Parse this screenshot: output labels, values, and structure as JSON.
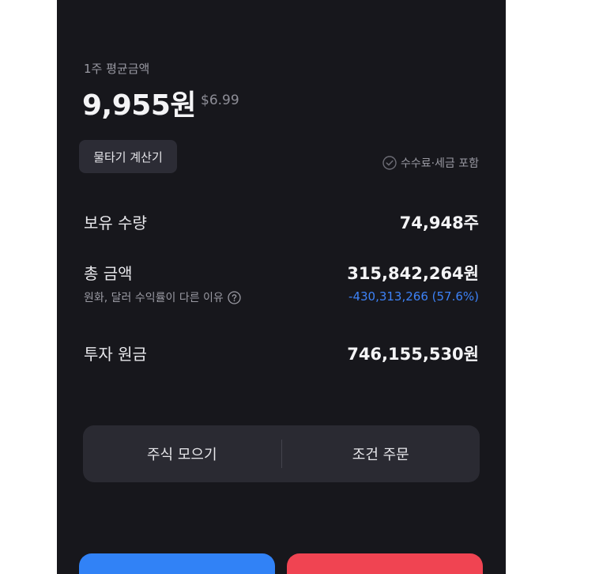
{
  "average": {
    "label": "1주 평균금액",
    "price": "9,955원",
    "usd": "$6.99"
  },
  "calculator": {
    "label": "물타기 계산기"
  },
  "fee_note": {
    "label": "수수료·세금 포함",
    "icon": "check-circle-icon"
  },
  "holdings": {
    "quantity_label": "보유 수량",
    "quantity_value": "74,948주",
    "total_label": "총 금액",
    "total_value": "315,842,264원",
    "fx_note": "원화, 달러 수익률이 다른 이유",
    "loss": "-430,313,266 (57.6%)",
    "principal_label": "투자 원금",
    "principal_value": "746,155,530원"
  },
  "actions": {
    "collect_label": "주식 모으기",
    "conditional_label": "조건 주문"
  },
  "colors": {
    "background": "#17171c",
    "loss": "#3d82f7",
    "buy": "#3182f6",
    "sell": "#f04452"
  }
}
